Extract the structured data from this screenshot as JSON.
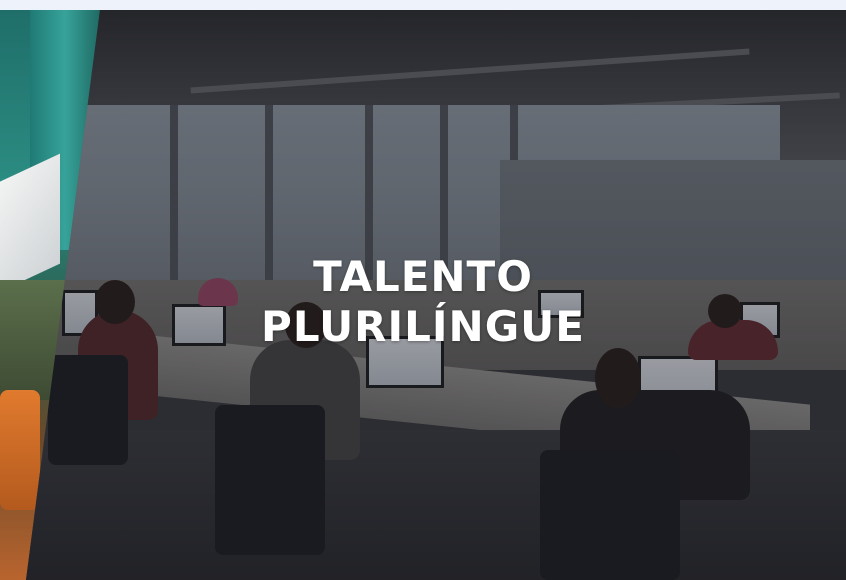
{
  "slide": {
    "headline_line1": "TALENTO",
    "headline_line2": "PLURILÍNGUE",
    "background_image": "office-call-center-photo",
    "overlay_color": "#14161c"
  },
  "previous_slide": {
    "background_image": "colorful-lounge-photo"
  }
}
